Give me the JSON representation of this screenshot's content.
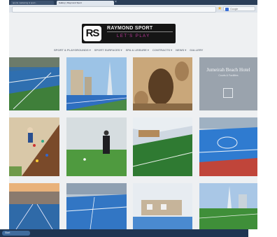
{
  "browser": {
    "tabs": [
      {
        "label": "sports marketing & sport..."
      },
      {
        "label": "Gallery | Raymond Sport"
      }
    ],
    "search_placeholder": "Google"
  },
  "site": {
    "logo": {
      "badge": "RS",
      "name": "RAYMOND SPORT",
      "tagline": "LET'S PLAY"
    },
    "menu": [
      "SPORT & PLAYGROUNDS ▾",
      "SPORT SURFACES ▾",
      "SPA & LEISURE ▾",
      "CONTRACTS ▾",
      "NEWS ▾",
      "GALLERY"
    ],
    "gallery": {
      "featured_tile": {
        "title": "Jumeirah Beach Hotel",
        "subtitle": "Courts & Facilities"
      }
    }
  },
  "taskbar": {
    "start_label": "Start"
  },
  "colors": {
    "court_blue": "#2f6fc0",
    "court_green": "#3f8a3a",
    "logo_tagline": "#c23ba0"
  }
}
